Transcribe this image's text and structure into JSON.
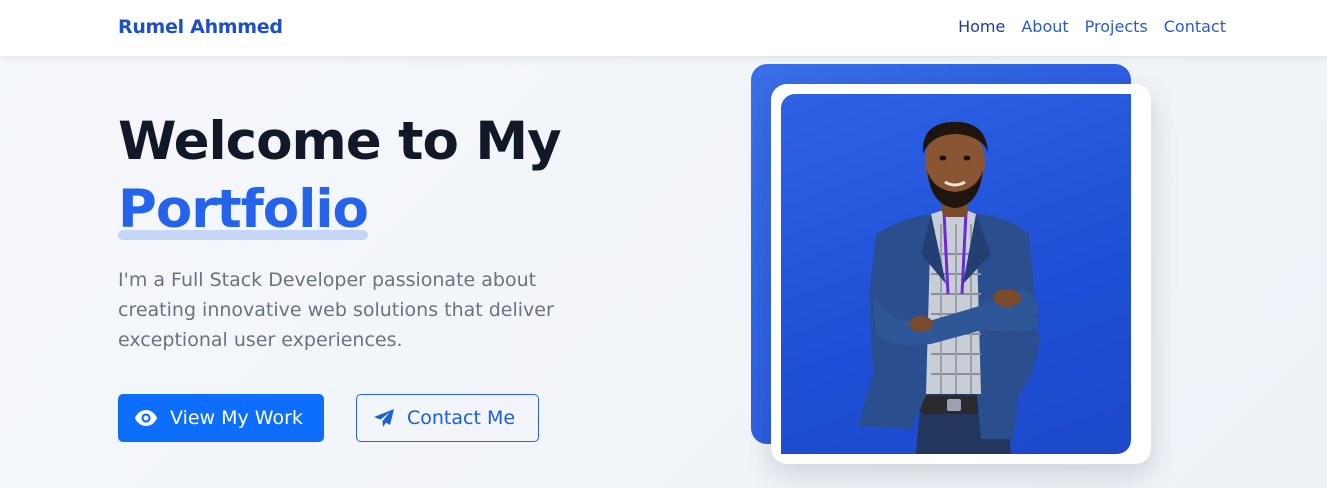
{
  "nav": {
    "brand": "Rumel Ahmmed",
    "links": [
      {
        "label": "Home",
        "active": true
      },
      {
        "label": "About",
        "active": false
      },
      {
        "label": "Projects",
        "active": false
      },
      {
        "label": "Contact",
        "active": false
      }
    ]
  },
  "hero": {
    "title_line1": "Welcome to My",
    "title_highlight": "Portfolio",
    "description": "I'm a Full Stack Developer passionate about creating innovative web solutions that deliver exceptional user experiences.",
    "buttons": {
      "primary": {
        "label": "View My Work",
        "icon": "eye-icon"
      },
      "secondary": {
        "label": "Contact Me",
        "icon": "paper-plane-icon"
      }
    }
  },
  "colors": {
    "brand": "#1e4fc4",
    "accent": "#2563eb",
    "primary_button": "#0d6efd",
    "photo_background": "#1f4fd8"
  }
}
